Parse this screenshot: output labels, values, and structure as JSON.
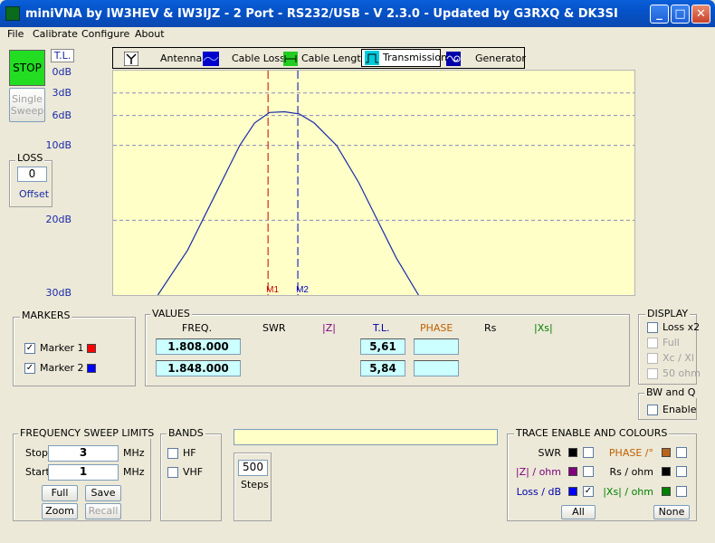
{
  "window": {
    "title": "miniVNA by IW3HEV & IW3IJZ - 2 Port - RS232/USB - V 2.3.0 - Updated by G3RXQ & DK3SI"
  },
  "menu": [
    "File",
    "Calibrate",
    "Configure",
    "About"
  ],
  "left": {
    "stop": "STOP",
    "single_sweep": [
      "Single",
      "Sweep"
    ],
    "mode": "T.L.",
    "loss_title": "LOSS",
    "loss_value": "0",
    "offset": "Offset"
  },
  "tabs": [
    {
      "label": "Antenna",
      "icon": "antenna-icon"
    },
    {
      "label": "Cable Loss",
      "icon": "cable-loss-icon"
    },
    {
      "label": "Cable Length",
      "icon": "cable-length-icon"
    },
    {
      "label": "Transmission",
      "icon": "transmission-icon"
    },
    {
      "label": "Generator",
      "icon": "generator-icon"
    }
  ],
  "chart_data": {
    "type": "line",
    "y_ticks": [
      "0dB",
      "3dB",
      "6dB",
      "10dB",
      "20dB",
      "30dB"
    ],
    "y_tick_values": [
      0,
      3,
      6,
      10,
      20,
      30
    ],
    "ylim": [
      0,
      30
    ],
    "xlim": [
      1.6,
      2.3
    ],
    "y_inverted": true,
    "grid": "dashed horizontal",
    "background": "#ffffc8",
    "trace_color": "#1a2aa8",
    "series": [
      {
        "x": [
          1.66,
          1.7,
          1.74,
          1.77,
          1.79,
          1.81,
          1.83,
          1.85,
          1.87,
          1.9,
          1.93,
          1.96,
          1.98,
          2.01
        ],
        "y": [
          30,
          24,
          16,
          10,
          7,
          5.6,
          5.5,
          5.8,
          7,
          10,
          15,
          21,
          25,
          30
        ]
      }
    ],
    "markers": [
      {
        "label": "M1",
        "x": 1.808,
        "color": "#cc0000"
      },
      {
        "label": "M2",
        "x": 1.848,
        "color": "#0000cc"
      }
    ]
  },
  "markers": {
    "title": "MARKERS",
    "items": [
      {
        "label": "Marker 1",
        "checked": true,
        "color": "#ff0000"
      },
      {
        "label": "Marker 2",
        "checked": true,
        "color": "#0000ff"
      }
    ]
  },
  "values": {
    "title": "VALUES",
    "headers": {
      "freq": "FREQ.",
      "swr": "SWR",
      "z": "|Z|",
      "tl": "T.L.",
      "phase": "PHASE",
      "rs": "Rs",
      "xs": "|Xs|"
    },
    "header_colors": {
      "swr": "#000000",
      "z": "#800080",
      "tl": "#0000aa",
      "phase": "#c06000",
      "rs": "#000000",
      "xs": "#008000"
    },
    "rows": [
      {
        "freq": "1.808.000",
        "tl": "5,61",
        "phase": ""
      },
      {
        "freq": "1.848.000",
        "tl": "5,84",
        "phase": ""
      }
    ]
  },
  "display": {
    "title": "DISPLAY",
    "items": [
      {
        "label": "Loss x2",
        "enabled": true
      },
      {
        "label": "Full",
        "enabled": false
      },
      {
        "label": "Xc / Xl",
        "enabled": false
      },
      {
        "label": "50 ohm",
        "enabled": false
      }
    ]
  },
  "bwq": {
    "title": "BW and Q",
    "enable": "Enable"
  },
  "sweep": {
    "title": "FREQUENCY SWEEP LIMITS",
    "stop_label": "Stop",
    "stop": "3",
    "start_label": "Start",
    "start": "1",
    "unit": "MHz",
    "full": "Full",
    "save": "Save",
    "zoom": "Zoom",
    "recall": "Recall"
  },
  "bands": {
    "title": "BANDS",
    "hf": "HF",
    "vhf": "VHF"
  },
  "status_text": "",
  "steps": {
    "value": "500",
    "label": "Steps"
  },
  "trace": {
    "title": "TRACE ENABLE AND COLOURS",
    "items": [
      {
        "label": "SWR",
        "color": "#000000",
        "swatch": "#000000",
        "checked": false
      },
      {
        "label": "PHASE /°",
        "color": "#c06000",
        "swatch": "#b8651b",
        "checked": false
      },
      {
        "label": "|Z| / ohm",
        "color": "#800080",
        "swatch": "#800080",
        "checked": false
      },
      {
        "label": "Rs / ohm",
        "color": "#000000",
        "swatch": "#000000",
        "checked": false
      },
      {
        "label": "Loss / dB",
        "color": "#0000aa",
        "swatch": "#0000ff",
        "checked": true
      },
      {
        "label": "|Xs| / ohm",
        "color": "#008000",
        "swatch": "#008000",
        "checked": false
      }
    ],
    "all": "All",
    "none": "None"
  }
}
